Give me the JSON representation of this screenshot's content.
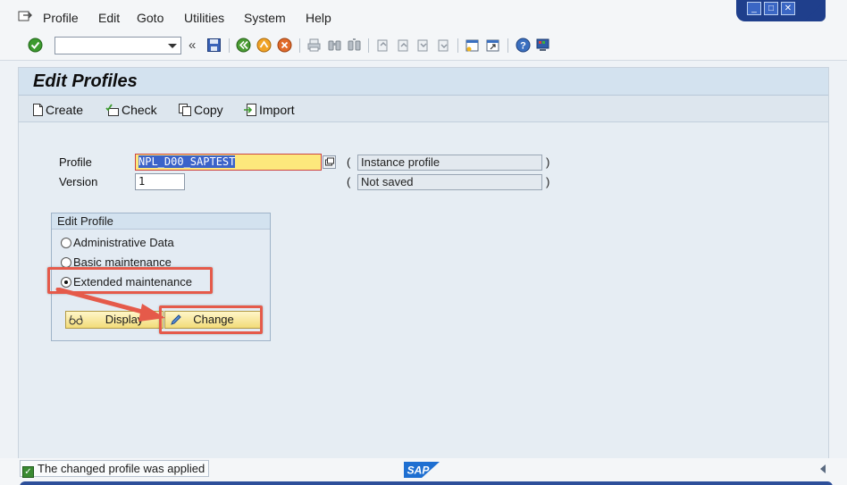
{
  "menu": {
    "items": [
      {
        "label": "Profile",
        "id": "profile"
      },
      {
        "label": "Edit",
        "id": "edit"
      },
      {
        "label": "Goto",
        "id": "goto"
      },
      {
        "label": "Utilities",
        "id": "utilities"
      },
      {
        "label": "System",
        "id": "system"
      },
      {
        "label": "Help",
        "id": "help"
      }
    ]
  },
  "toolbar": {
    "command_field_value": "",
    "back_nav": "«"
  },
  "screen": {
    "title": "Edit Profiles",
    "actions": {
      "create": "Create",
      "check": "Check",
      "copy": "Copy",
      "import": "Import"
    }
  },
  "form": {
    "profile_label": "Profile",
    "profile_value": "NPL_D00_SAPTEST",
    "profile_type": "Instance profile",
    "version_label": "Version",
    "version_value": "1",
    "version_status": "Not saved",
    "open_paren": "(",
    "close_paren": ")"
  },
  "edit_profile": {
    "title": "Edit Profile",
    "options": {
      "administrative": "Administrative Data",
      "basic": "Basic maintenance",
      "extended": "Extended maintenance"
    },
    "selected": "extended",
    "display_button": "Display",
    "change_button": "Change"
  },
  "annotations": {
    "highlight_color": "#e55a4a"
  },
  "status": {
    "message": "The changed profile was applied",
    "logo_text": "SAP"
  }
}
